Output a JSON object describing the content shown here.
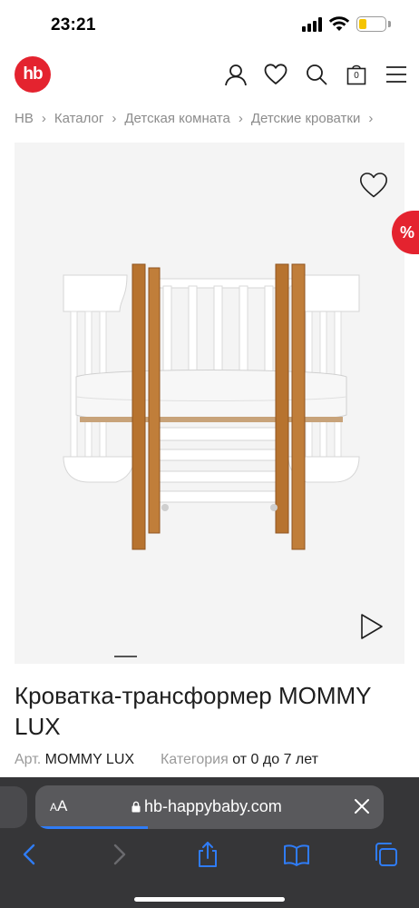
{
  "status_bar": {
    "time": "23:21"
  },
  "header": {
    "logo_text": "hb",
    "cart_count": "0",
    "brand_color": "#e4232f"
  },
  "breadcrumb": [
    "HB",
    "Каталог",
    "Детская комната",
    "Детские кроватки"
  ],
  "gallery": {
    "promo_badge": "%"
  },
  "product": {
    "title": "Кроватка-трансформер MOMMY LUX",
    "article_label": "Арт.",
    "article_value": "MOMMY LUX",
    "category_label": "Категория",
    "category_value": "от 0 до 7 лет"
  },
  "browser": {
    "text_size_button": "AA",
    "url": "hb-happybaby.com",
    "accent_color": "#2f7cf6"
  }
}
